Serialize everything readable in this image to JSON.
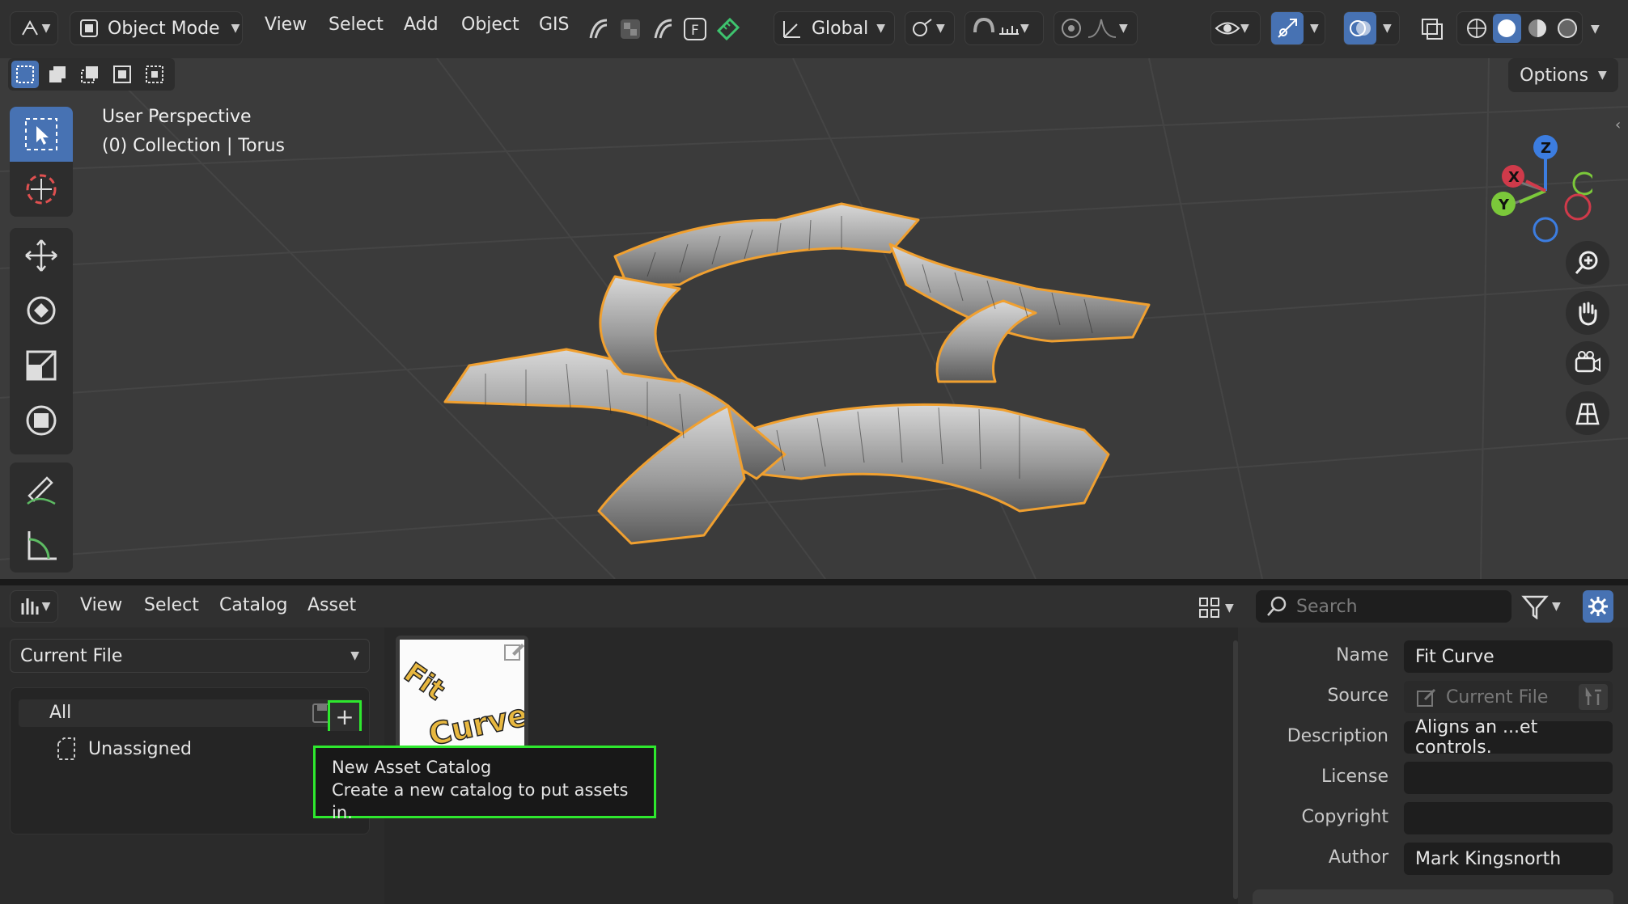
{
  "header": {
    "mode_label": "Object Mode",
    "menus": [
      "View",
      "Select",
      "Add",
      "Object",
      "GIS"
    ],
    "transform_orientation": "Global",
    "options_label": "Options"
  },
  "viewport": {
    "perspective_label": "User Perspective",
    "collection_label": "(0) Collection | Torus",
    "gizmo": {
      "z": "Z",
      "x": "X",
      "y": "Y"
    }
  },
  "asset_browser": {
    "menus": [
      "View",
      "Select",
      "Catalog",
      "Asset"
    ],
    "search_placeholder": "Search",
    "library_select": "Current File",
    "catalogs": {
      "all": "All",
      "unassigned": "Unassigned"
    },
    "thumbnail_text": "Fit Curve",
    "tooltip": {
      "title": "New Asset Catalog",
      "description": "Create a new catalog to put assets in."
    },
    "metadata": {
      "name_label": "Name",
      "name_value": "Fit Curve",
      "source_label": "Source",
      "source_value": "Current File",
      "description_label": "Description",
      "description_value": "Aligns an ...et controls.",
      "license_label": "License",
      "license_value": "",
      "copyright_label": "Copyright",
      "copyright_value": "",
      "author_label": "Author",
      "author_value": "Mark Kingsnorth"
    }
  },
  "colors": {
    "accent": "#4772b3",
    "selection_outline": "#f0a030",
    "tooltip_highlight": "#2ee82e"
  }
}
